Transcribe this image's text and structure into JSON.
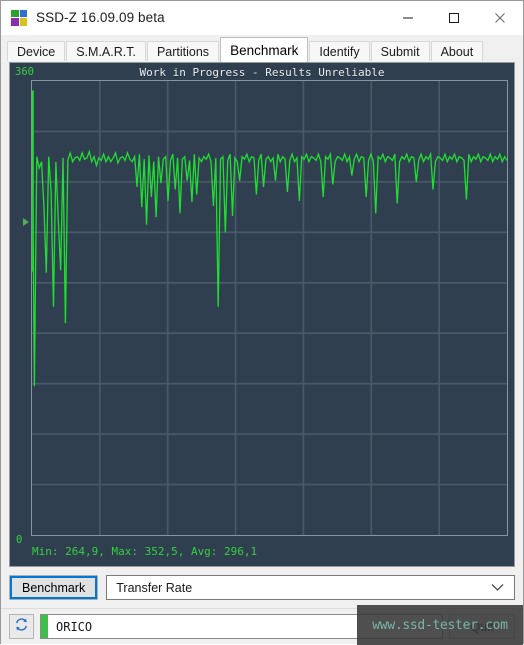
{
  "window": {
    "title": "SSD-Z 16.09.09 beta",
    "icon": "app-logo-icon",
    "minimize_label": "—",
    "maximize_label": "□",
    "close_label": "✕"
  },
  "tabs": [
    {
      "label": "Device",
      "active": false
    },
    {
      "label": "S.M.A.R.T.",
      "active": false
    },
    {
      "label": "Partitions",
      "active": false
    },
    {
      "label": "Benchmark",
      "active": true
    },
    {
      "label": "Identify",
      "active": false
    },
    {
      "label": "Submit",
      "active": false
    },
    {
      "label": "About",
      "active": false
    }
  ],
  "chart": {
    "title": "Work in Progress - Results Unreliable",
    "y_max_label": "360",
    "y_min_label": "0",
    "stats_line": "Min: 264,9, Max: 352,5, Avg: 296,1",
    "marker": "current-position-marker"
  },
  "controls": {
    "benchmark_button": "Benchmark",
    "mode_select_value": "Transfer Rate",
    "chevron": "chevron-down-icon"
  },
  "statusbar": {
    "refresh_icon": "refresh-icon",
    "device_name": "ORICO",
    "quit_button": "Quit",
    "watermark": "www.ssd-tester.com"
  },
  "colors": {
    "chart_bg": "#2f3f4f",
    "trace": "#22dd33",
    "grid": "#4b5a68",
    "axis_text": "#35d13f",
    "accent": "#0078d7"
  },
  "chart_data": {
    "type": "line",
    "title": "Work in Progress - Results Unreliable",
    "xlabel": "",
    "ylabel": "",
    "ylim": [
      0,
      360
    ],
    "grid": true,
    "legend": null,
    "stats": {
      "min": 264.9,
      "max": 352.5,
      "avg": 296.1
    },
    "y_ticks": [
      0,
      360
    ],
    "series": [
      {
        "name": "Transfer Rate",
        "values": [
          352.5,
          118.0,
          300.0,
          291.0,
          296.0,
          260.0,
          208.0,
          300.0,
          272.0,
          181.0,
          296.0,
          250.0,
          210.0,
          299.0,
          168.0,
          297.0,
          303.0,
          296.0,
          299.0,
          300.0,
          297.0,
          303.0,
          298.0,
          299.0,
          304.0,
          296.0,
          300.0,
          293.0,
          299.0,
          297.0,
          302.0,
          296.0,
          300.0,
          296.0,
          299.0,
          303.0,
          295.0,
          299.0,
          300.0,
          297.0,
          303.0,
          298.0,
          296.0,
          300.0,
          276.0,
          302.0,
          260.0,
          298.0,
          246.0,
          301.0,
          268.0,
          296.0,
          252.0,
          300.0,
          279.0,
          298.0,
          300.0,
          265.0,
          297.0,
          302.0,
          274.0,
          299.0,
          255.0,
          298.0,
          300.0,
          281.0,
          297.0,
          264.0,
          302.0,
          270.0,
          299.0,
          296.0,
          300.0,
          298.0,
          302.0,
          296.0,
          261.0,
          299.0,
          181.0,
          298.0,
          300.0,
          240.0,
          297.0,
          302.0,
          253.0,
          299.0,
          296.0,
          281.0,
          300.0,
          298.0,
          302.0,
          296.0,
          300.0,
          299.0,
          270.0,
          297.0,
          302.0,
          276.0,
          298.0,
          300.0,
          296.0,
          299.0,
          281.0,
          302.0,
          296.0,
          300.0,
          298.0,
          272.0,
          297.0,
          302.0,
          296.0,
          299.0,
          264.9,
          300.0,
          298.0,
          302.0,
          296.0,
          300.0,
          299.0,
          297.0,
          302.0,
          296.0,
          268.0,
          300.0,
          298.0,
          302.0,
          278.0,
          296.0,
          300.0,
          299.0,
          297.0,
          302.0,
          296.0,
          300.0,
          285.0,
          298.0,
          302.0,
          296.0,
          300.0,
          299.0,
          268.0,
          297.0,
          302.0,
          296.0,
          255.0,
          300.0,
          298.0,
          302.0,
          296.0,
          300.0,
          299.0,
          297.0,
          302.0,
          263.0,
          296.0,
          300.0,
          298.0,
          302.0,
          296.0,
          300.0,
          299.0,
          280.0,
          297.0,
          302.0,
          296.0,
          300.0,
          298.0,
          302.0,
          274.0,
          296.0,
          300.0,
          299.0,
          297.0,
          302.0,
          296.0,
          300.0,
          298.0,
          302.0,
          296.0,
          300.0,
          299.0,
          297.0,
          266.0,
          302.0,
          296.0,
          300.0,
          298.0,
          302.0,
          296.0,
          300.0,
          299.0,
          297.0,
          302.0,
          296.0,
          300.0,
          298.0,
          302.0,
          296.0,
          300.0,
          297.0
        ]
      }
    ]
  }
}
